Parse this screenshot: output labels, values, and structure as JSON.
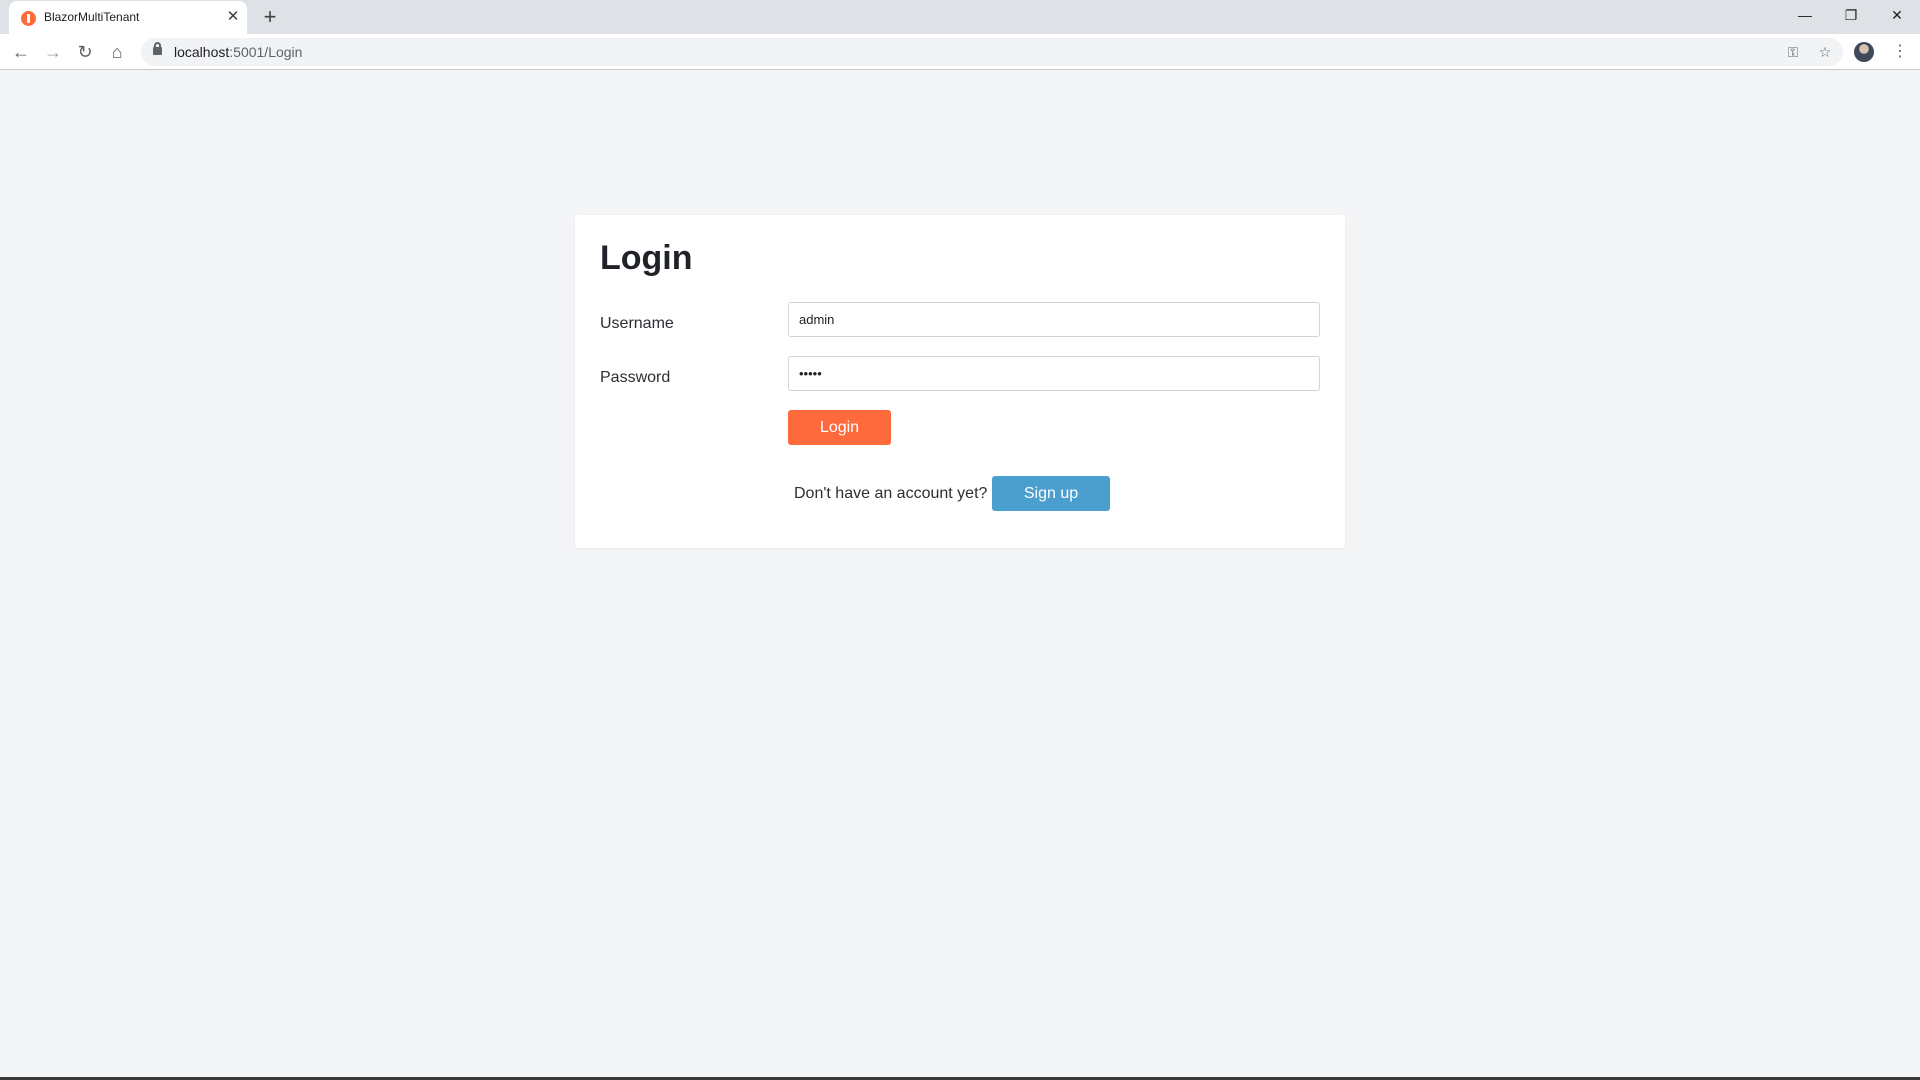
{
  "browser": {
    "tab_title": "BlazorMultiTenant",
    "tab_close": "✕",
    "new_tab": "+",
    "url_host": "localhost",
    "url_path": ":5001/Login",
    "icons": {
      "back": "←",
      "forward": "→",
      "reload": "↻",
      "home": "⌂",
      "key": "⚿",
      "star": "☆",
      "menu": "⋮",
      "minimize": "—",
      "restore": "❐",
      "close": "✕"
    }
  },
  "login_card": {
    "title": "Login",
    "username_label": "Username",
    "username_value": "admin",
    "password_label": "Password",
    "password_value": "admin",
    "login_button": "Login",
    "signup_prompt": "Don't have an account yet?",
    "signup_button": "Sign up"
  },
  "colors": {
    "login_button": "#ff6a3d",
    "signup_button": "#4b9fcf",
    "page_background": "#f4f5f7"
  }
}
